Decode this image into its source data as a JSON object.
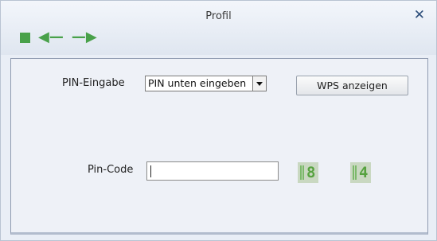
{
  "window": {
    "title": "Profil",
    "close_symbol": "✕"
  },
  "toolbar": {
    "stop_icon": "stop-icon",
    "back_symbol": "🡸",
    "forward_symbol": "🡺",
    "accent_color": "#49a14a"
  },
  "form": {
    "pin_entry_label": "PIN-Eingabe",
    "pin_entry_selected": "PIN unten eingeben",
    "wps_button_label": "WPS anzeigen",
    "pin_code_label": "Pin-Code",
    "pin_code_value": "",
    "pin_digits": [
      "8",
      "4"
    ]
  }
}
